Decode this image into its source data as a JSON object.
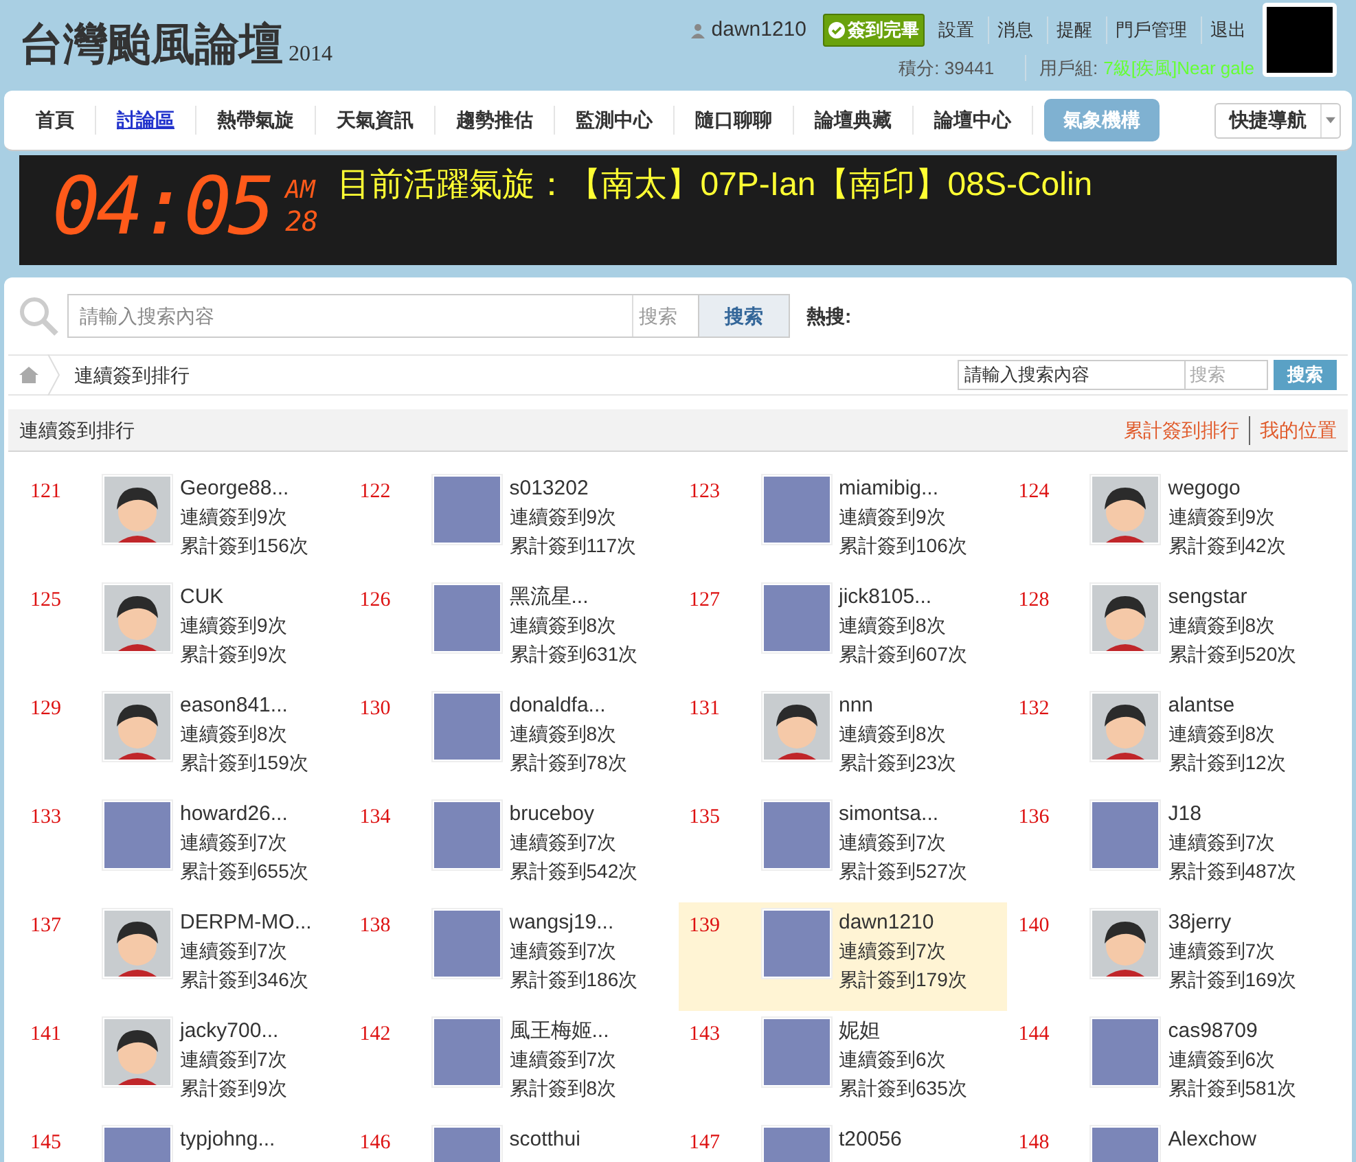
{
  "header": {
    "logo_title": "台灣颱風論壇",
    "logo_year": "2014",
    "username": "dawn1210",
    "signin_badge": "簽到完畢",
    "user_links": [
      "設置",
      "消息",
      "提醒",
      "門戶管理",
      "退出"
    ],
    "points_label": "積分: 39441",
    "group_label": "用戶組:",
    "group_value": "7級[疾風]Near gale"
  },
  "nav": {
    "items": [
      {
        "label": "首頁",
        "selected": false,
        "kind": "plain"
      },
      {
        "label": "討論區",
        "selected": true,
        "kind": "plain"
      },
      {
        "label": "熱帶氣旋",
        "selected": false,
        "kind": "plain"
      },
      {
        "label": "天氣資訊",
        "selected": false,
        "kind": "plain"
      },
      {
        "label": "趨勢推估",
        "selected": false,
        "kind": "plain"
      },
      {
        "label": "監測中心",
        "selected": false,
        "kind": "plain"
      },
      {
        "label": "隨口聊聊",
        "selected": false,
        "kind": "plain"
      },
      {
        "label": "論壇典藏",
        "selected": false,
        "kind": "plain"
      },
      {
        "label": "論壇中心",
        "selected": false,
        "kind": "plain"
      },
      {
        "label": "氣象機構",
        "selected": false,
        "kind": "pill"
      }
    ],
    "quick_nav": "快捷導航"
  },
  "banner": {
    "clock": "04:05",
    "meridiem": "AM",
    "day": "28",
    "message": "目前活躍氣旋：【南太】07P-Ian【南印】08S-Colin"
  },
  "search": {
    "placeholder": "請輸入搜索內容",
    "type": "搜索",
    "button": "搜索",
    "hot_label": "熱搜:"
  },
  "breadcrumb": {
    "current": "連續簽到排行",
    "search_value": "請輸入搜索內容",
    "search_type": "搜索",
    "search_button": "搜索"
  },
  "section": {
    "title": "連續簽到排行",
    "links": [
      "累計簽到排行",
      "我的位置"
    ]
  },
  "ranking": [
    {
      "rank": "121",
      "name": "George88...",
      "streak": "連續簽到9次",
      "total": "累計簽到156次",
      "kind": "cartoon",
      "selected": false
    },
    {
      "rank": "122",
      "name": "s013202",
      "streak": "連續簽到9次",
      "total": "累計簽到117次",
      "kind": "image",
      "selected": false
    },
    {
      "rank": "123",
      "name": "miamibig...",
      "streak": "連續簽到9次",
      "total": "累計簽到106次",
      "kind": "image",
      "selected": false
    },
    {
      "rank": "124",
      "name": "wegogo",
      "streak": "連續簽到9次",
      "total": "累計簽到42次",
      "kind": "cartoon",
      "selected": false
    },
    {
      "rank": "125",
      "name": "CUK",
      "streak": "連續簽到9次",
      "total": "累計簽到9次",
      "kind": "cartoon",
      "selected": false
    },
    {
      "rank": "126",
      "name": "黑流星...",
      "streak": "連續簽到8次",
      "total": "累計簽到631次",
      "kind": "image",
      "selected": false
    },
    {
      "rank": "127",
      "name": "jick8105...",
      "streak": "連續簽到8次",
      "total": "累計簽到607次",
      "kind": "image",
      "selected": false
    },
    {
      "rank": "128",
      "name": "sengstar",
      "streak": "連續簽到8次",
      "total": "累計簽到520次",
      "kind": "cartoon",
      "selected": false
    },
    {
      "rank": "129",
      "name": "eason841...",
      "streak": "連續簽到8次",
      "total": "累計簽到159次",
      "kind": "cartoon",
      "selected": false
    },
    {
      "rank": "130",
      "name": "donaldfa...",
      "streak": "連續簽到8次",
      "total": "累計簽到78次",
      "kind": "image",
      "selected": false
    },
    {
      "rank": "131",
      "name": "nnn",
      "streak": "連續簽到8次",
      "total": "累計簽到23次",
      "kind": "cartoon",
      "selected": false
    },
    {
      "rank": "132",
      "name": "alantse",
      "streak": "連續簽到8次",
      "total": "累計簽到12次",
      "kind": "cartoon",
      "selected": false
    },
    {
      "rank": "133",
      "name": "howard26...",
      "streak": "連續簽到7次",
      "total": "累計簽到655次",
      "kind": "image",
      "selected": false
    },
    {
      "rank": "134",
      "name": "bruceboy",
      "streak": "連續簽到7次",
      "total": "累計簽到542次",
      "kind": "image",
      "selected": false
    },
    {
      "rank": "135",
      "name": "simontsa...",
      "streak": "連續簽到7次",
      "total": "累計簽到527次",
      "kind": "image",
      "selected": false
    },
    {
      "rank": "136",
      "name": "J18",
      "streak": "連續簽到7次",
      "total": "累計簽到487次",
      "kind": "image",
      "selected": false
    },
    {
      "rank": "137",
      "name": "DERPM-MO...",
      "streak": "連續簽到7次",
      "total": "累計簽到346次",
      "kind": "cartoon",
      "selected": false
    },
    {
      "rank": "138",
      "name": "wangsj19...",
      "streak": "連續簽到7次",
      "total": "累計簽到186次",
      "kind": "image",
      "selected": false
    },
    {
      "rank": "139",
      "name": "dawn1210",
      "streak": "連續簽到7次",
      "total": "累計簽到179次",
      "kind": "image",
      "selected": true
    },
    {
      "rank": "140",
      "name": "38jerry",
      "streak": "連續簽到7次",
      "total": "累計簽到169次",
      "kind": "cartoon",
      "selected": false
    },
    {
      "rank": "141",
      "name": "jacky700...",
      "streak": "連續簽到7次",
      "total": "累計簽到9次",
      "kind": "cartoon",
      "selected": false
    },
    {
      "rank": "142",
      "name": "風王梅姬...",
      "streak": "連續簽到7次",
      "total": "累計簽到8次",
      "kind": "image",
      "selected": false
    },
    {
      "rank": "143",
      "name": "妮妲",
      "streak": "連續簽到6次",
      "total": "累計簽到635次",
      "kind": "image",
      "selected": false
    },
    {
      "rank": "144",
      "name": "cas98709",
      "streak": "連續簽到6次",
      "total": "累計簽到581次",
      "kind": "image",
      "selected": false
    },
    {
      "rank": "145",
      "name": "typjohng...",
      "kind": "image",
      "selected": false
    },
    {
      "rank": "146",
      "name": "scotthui",
      "kind": "image",
      "selected": false
    },
    {
      "rank": "147",
      "name": "t20056",
      "kind": "image",
      "selected": false
    },
    {
      "rank": "148",
      "name": "Alexchow",
      "kind": "image",
      "selected": false
    }
  ]
}
